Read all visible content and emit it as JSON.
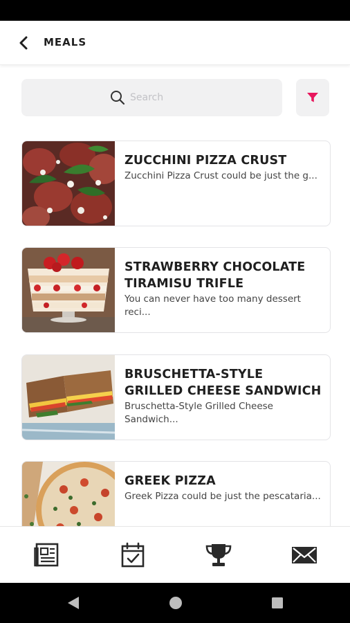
{
  "header": {
    "title": "MEALS"
  },
  "search": {
    "placeholder": "Search"
  },
  "colors": {
    "accent": "#e8175d",
    "text": "#1f1f1f",
    "search_bg": "#f1f1f2"
  },
  "meals": [
    {
      "title": "ZUCCHINI PIZZA CRUST",
      "description": "Zucchini Pizza Crust could be just the g..."
    },
    {
      "title": "STRAWBERRY CHOCOLATE TIRAMISU TRIFLE",
      "description": "You can never have too many dessert reci..."
    },
    {
      "title": "BRUSCHETTA-STYLE GRILLED CHEESE SANDWICH",
      "description": "Bruschetta-Style Grilled Cheese Sandwich..."
    },
    {
      "title": "GREEK PIZZA",
      "description": "Greek Pizza could be just the pescataria..."
    }
  ],
  "tabs": [
    {
      "icon": "newspaper-icon"
    },
    {
      "icon": "calendar-check-icon"
    },
    {
      "icon": "trophy-icon"
    },
    {
      "icon": "envelope-icon"
    }
  ]
}
